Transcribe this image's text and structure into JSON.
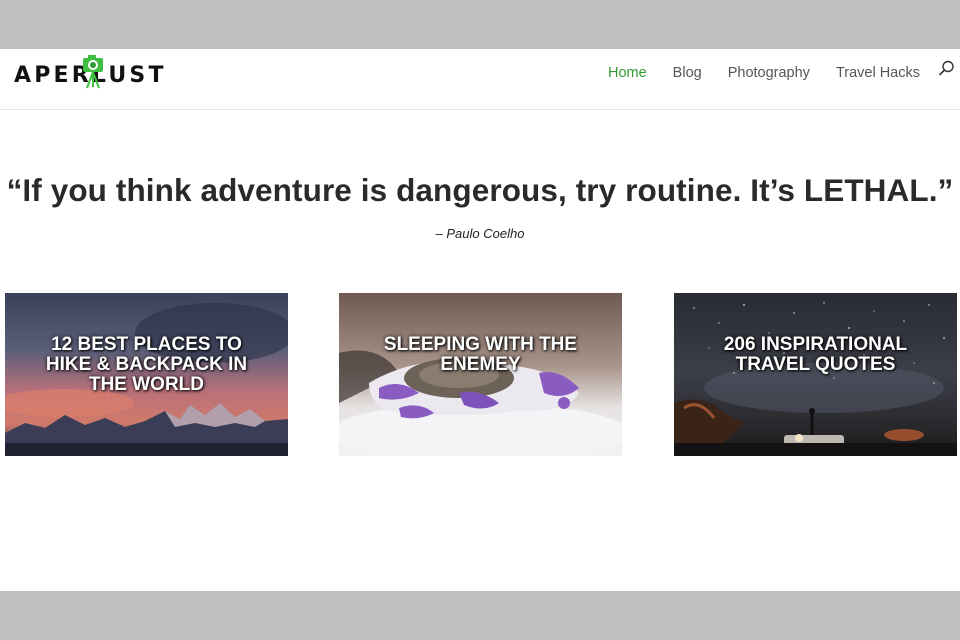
{
  "header": {
    "logo_text": "APERLUST",
    "nav": [
      {
        "label": "Home",
        "active": true
      },
      {
        "label": "Blog",
        "active": false
      },
      {
        "label": "Photography",
        "active": false
      },
      {
        "label": "Travel Hacks",
        "active": false
      }
    ],
    "search_icon": "search-icon",
    "accent_color": "#2f9a2f"
  },
  "hero": {
    "quote": "“If you think adventure is dangerous, try routine. It’s LETHAL.”",
    "author": "– Paulo Coelho"
  },
  "cards": [
    {
      "title": "12 BEST PLACES TO\nHIKE & BACKPACK IN\nTHE WORLD"
    },
    {
      "title": "SLEEPING WITH THE\nENEMEY"
    },
    {
      "title": "206 INSPIRATIONAL\nTRAVEL QUOTES"
    }
  ]
}
